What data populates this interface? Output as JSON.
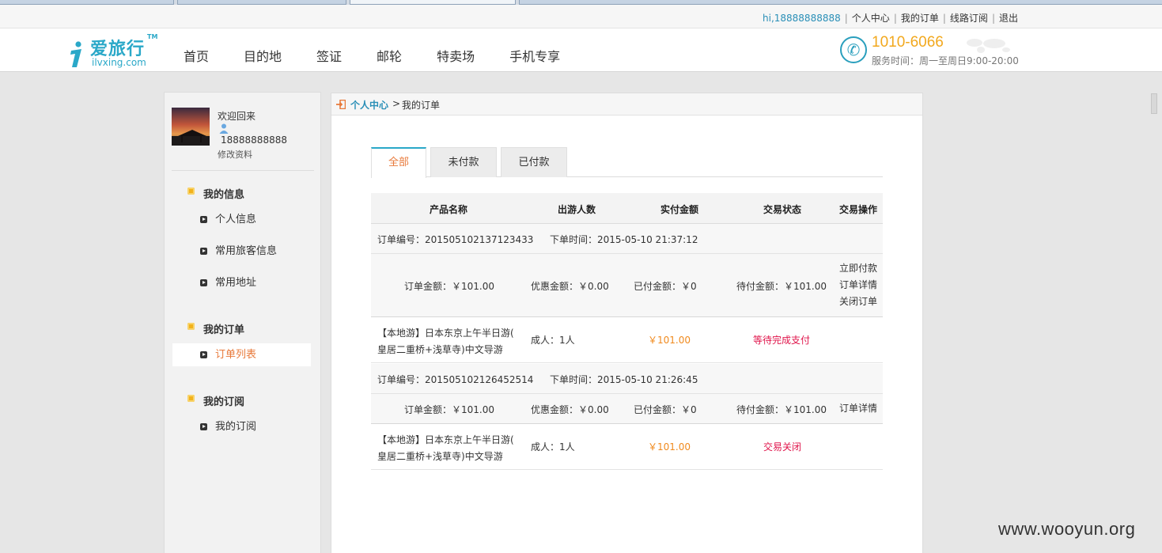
{
  "topbar": {
    "user": "hi,18888888888",
    "links": [
      "个人中心",
      "我的订单",
      "线路订阅",
      "退出"
    ]
  },
  "header": {
    "logo_cn": "爱旅行",
    "logo_tm": "TM",
    "logo_en": "ilvxing.com",
    "nav": [
      "首页",
      "目的地",
      "签证",
      "邮轮",
      "特卖场",
      "手机专享"
    ],
    "phone": "1010-6066",
    "hours": "服务时间：周一至周日9:00-20:00"
  },
  "sidebar": {
    "welcome": "欢迎回来",
    "phone": "18888888888",
    "edit": "修改资料",
    "groups": [
      {
        "title": "我的信息",
        "items": [
          "个人信息",
          "常用旅客信息",
          "常用地址"
        ]
      },
      {
        "title": "我的订单",
        "items": [
          "订单列表"
        ]
      },
      {
        "title": "我的订阅",
        "items": [
          "我的订阅"
        ]
      }
    ]
  },
  "breadcrumb": {
    "home": "个人中心",
    "sep": ">",
    "current": "我的订单"
  },
  "tabs": [
    "全部",
    "未付款",
    "已付款"
  ],
  "table": {
    "headers": [
      "产品名称",
      "出游人数",
      "实付金额",
      "交易状态",
      "交易操作"
    ],
    "orders": [
      {
        "order_no": "订单编号：201505102137123433",
        "order_time": "下单时间：2015-05-10 21:37:12",
        "amount": "订单金额：￥101.00",
        "discount": "优惠金额：￥0.00",
        "paid": "已付金额：￥0",
        "due": "待付金额：￥101.00",
        "actions": [
          "立即付款",
          "订单详情",
          "关闭订单"
        ],
        "product_line1": "【本地游】日本东京上午半日游(",
        "product_line2": "皇居二重桥+浅草寺)中文导游",
        "people": "成人：1人",
        "price": "￥101.00",
        "status": "等待完成支付"
      },
      {
        "order_no": "订单编号：201505102126452514",
        "order_time": "下单时间：2015-05-10 21:26:45",
        "amount": "订单金额：￥101.00",
        "discount": "优惠金额：￥0.00",
        "paid": "已付金额：￥0",
        "due": "待付金额：￥101.00",
        "actions": [
          "订单详情"
        ],
        "product_line1": "【本地游】日本东京上午半日游(",
        "product_line2": "皇居二重桥+浅草寺)中文导游",
        "people": "成人：1人",
        "price": "￥101.00",
        "status": "交易关闭"
      }
    ]
  },
  "watermark": "www.wooyun.org",
  "colors": {
    "brand": "#2aa8c8",
    "accent": "#e8793a",
    "price": "#f08a1e",
    "status": "#e0154b",
    "phone": "#f2a81d"
  }
}
